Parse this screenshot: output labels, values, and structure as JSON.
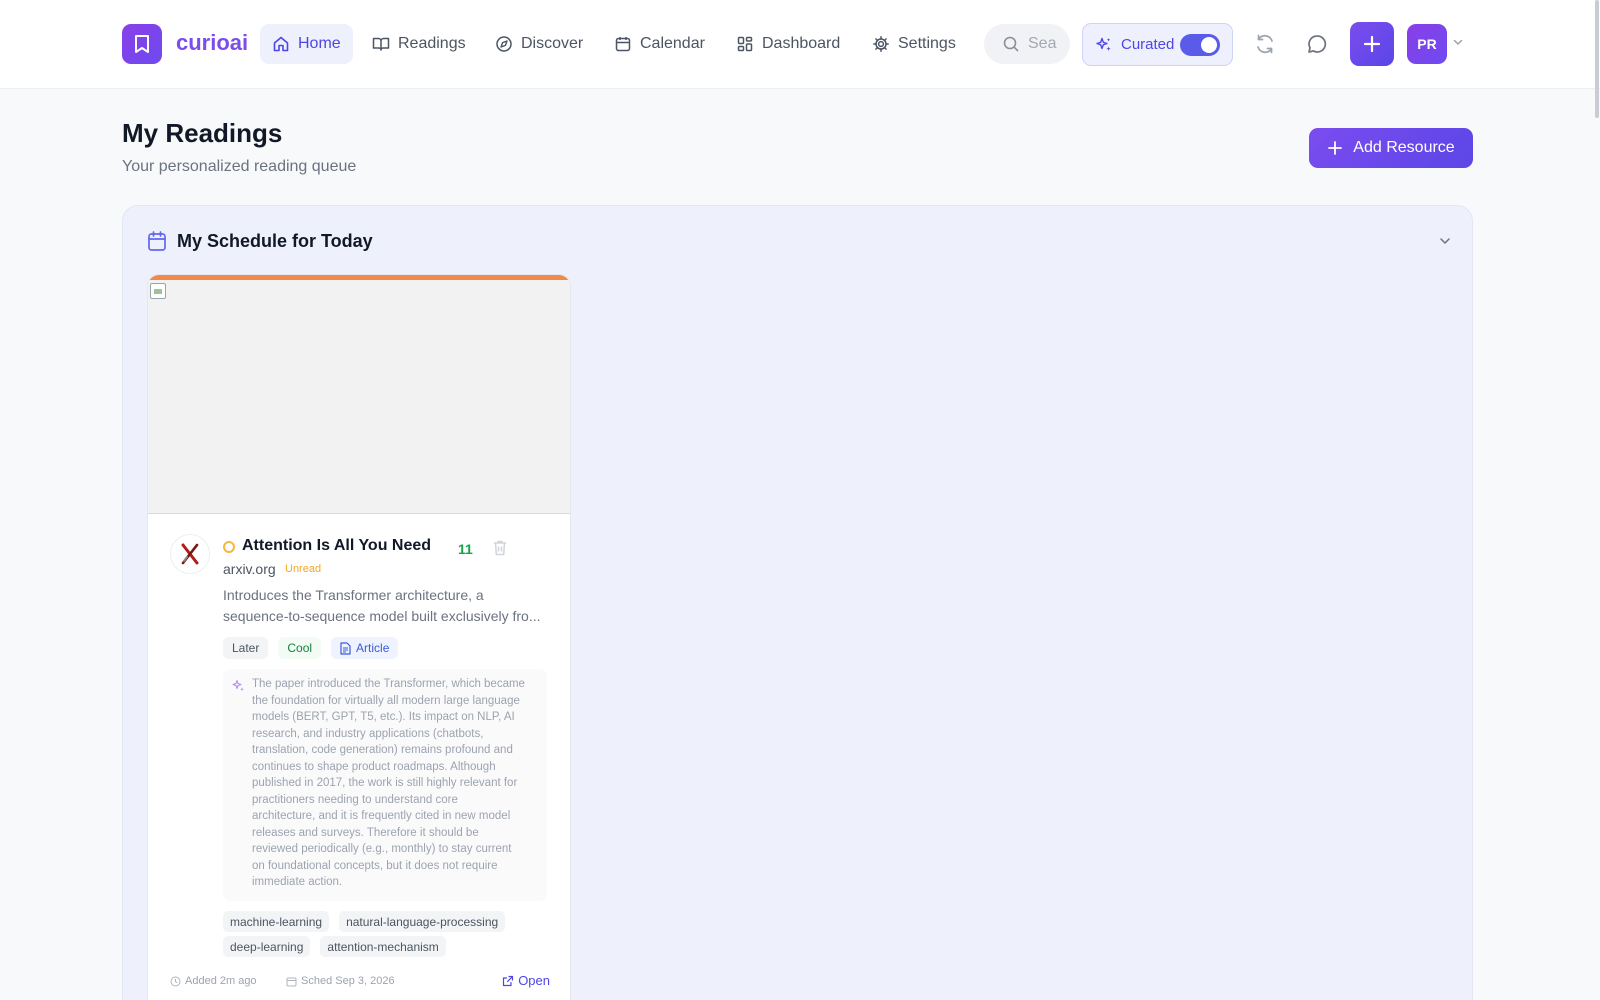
{
  "app": {
    "name": "curioai"
  },
  "nav": {
    "home": "Home",
    "readings": "Readings",
    "discover": "Discover",
    "calendar": "Calendar",
    "dashboard": "Dashboard",
    "settings": "Settings"
  },
  "search": {
    "placeholder": "Sea"
  },
  "curated": {
    "label": "Curated",
    "enabled": true
  },
  "user": {
    "initials": "PR"
  },
  "page": {
    "title": "My Readings",
    "subtitle": "Your personalized reading queue",
    "add_button": "Add Resource"
  },
  "schedule": {
    "title": "My Schedule for Today",
    "card": {
      "title": "Attention Is All You Need",
      "score": "11",
      "source": "arxiv.org",
      "status": "Unread",
      "description_lines": [
        "Introduces the Transformer architecture, a",
        "sequence-to-sequence model built exclusively fro..."
      ],
      "tags": {
        "priority": "Later",
        "mood": "Cool",
        "type": "Article"
      },
      "ai_summary_lines": [
        "The paper introduced the Transformer, which became",
        "the foundation for virtually all modern large language",
        "models (BERT, GPT, T5, etc.). Its impact on NLP, AI",
        "research, and industry applications (chatbots,",
        "translation, code generation) remains profound and",
        "continues to shape product roadmaps. Although",
        "published in 2017, the work is still highly relevant for",
        "practitioners needing to understand core",
        "architecture, and it is frequently cited in new model",
        "releases and surveys. Therefore it should be",
        "reviewed periodically (e.g., monthly) to stay current",
        "on foundational concepts, but it does not require",
        "immediate action."
      ],
      "topics": [
        "machine-learning",
        "natural-language-processing",
        "deep-learning",
        "attention-mechanism"
      ],
      "added": "Added 2m ago",
      "scheduled": "Sched Sep 3, 2026",
      "open": "Open"
    }
  },
  "colors": {
    "brand": "#7c4dec",
    "accent": "#4f46e5",
    "card_bar": "#f08a4b",
    "score": "#16a34a",
    "unread": "#f5a623"
  }
}
